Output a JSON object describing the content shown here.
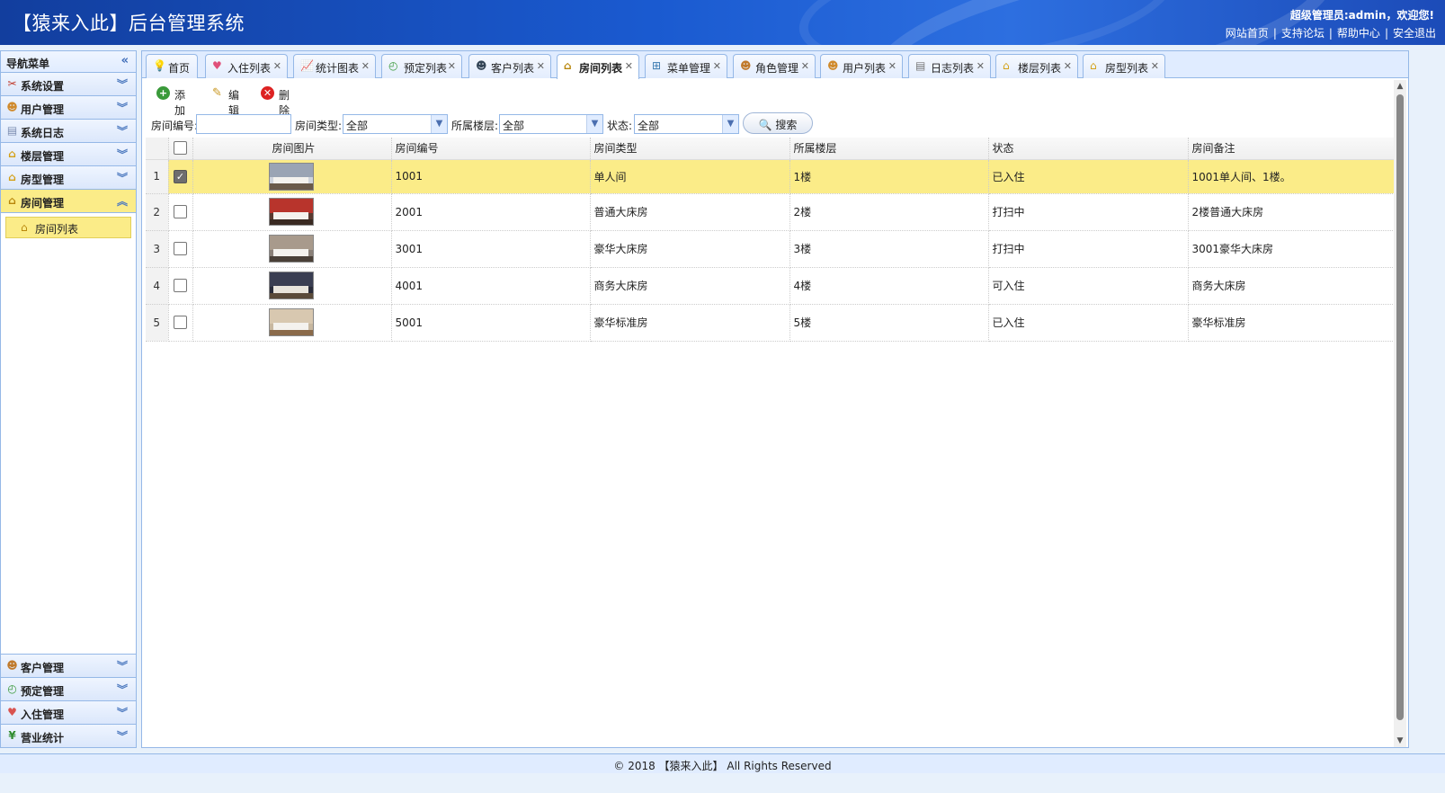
{
  "header": {
    "title": "【猿来入此】后台管理系统",
    "welcome": "超级管理员:admin，欢迎您!",
    "links": [
      "网站首页",
      "支持论坛",
      "帮助中心",
      "安全退出"
    ]
  },
  "sidebar": {
    "title": "导航菜单",
    "groups_top": [
      {
        "label": "系统设置",
        "icon": "tools-icon"
      },
      {
        "label": "用户管理",
        "icon": "user-icon"
      },
      {
        "label": "系统日志",
        "icon": "log-icon"
      },
      {
        "label": "楼层管理",
        "icon": "house-icon"
      },
      {
        "label": "房型管理",
        "icon": "house-icon"
      },
      {
        "label": "房间管理",
        "icon": "house-icon",
        "active": true
      }
    ],
    "sub_items": [
      {
        "label": "房间列表",
        "icon": "house-icon"
      }
    ],
    "groups_bottom": [
      {
        "label": "客户管理",
        "icon": "users-icon"
      },
      {
        "label": "预定管理",
        "icon": "clock-icon"
      },
      {
        "label": "入住管理",
        "icon": "heart-icon"
      },
      {
        "label": "营业统计",
        "icon": "yen-icon"
      }
    ]
  },
  "tabs": [
    {
      "label": "首页",
      "icon": "bulb-icon",
      "closable": false
    },
    {
      "label": "入住列表",
      "icon": "heart-icon",
      "closable": true
    },
    {
      "label": "统计图表",
      "icon": "chart-icon",
      "closable": true
    },
    {
      "label": "预定列表",
      "icon": "clock-icon",
      "closable": true
    },
    {
      "label": "客户列表",
      "icon": "person-icon",
      "closable": true
    },
    {
      "label": "房间列表",
      "icon": "house-icon",
      "closable": true,
      "active": true
    },
    {
      "label": "菜单管理",
      "icon": "sitemap-icon",
      "closable": true
    },
    {
      "label": "角色管理",
      "icon": "users-icon",
      "closable": true
    },
    {
      "label": "用户列表",
      "icon": "user-icon",
      "closable": true
    },
    {
      "label": "日志列表",
      "icon": "document-icon",
      "closable": true
    },
    {
      "label": "楼层列表",
      "icon": "house-icon",
      "closable": true
    },
    {
      "label": "房型列表",
      "icon": "house-icon",
      "closable": true
    }
  ],
  "toolbar": {
    "add": "添加",
    "edit": "编辑",
    "delete": "删除"
  },
  "search": {
    "room_no_label": "房间编号:",
    "room_no_value": "",
    "room_type_label": "房间类型:",
    "room_type_value": "全部",
    "floor_label": "所属楼层:",
    "floor_value": "全部",
    "status_label": "状态:",
    "status_value": "全部",
    "button": "搜索"
  },
  "grid": {
    "columns": [
      "房间图片",
      "房间编号",
      "房间类型",
      "所属楼层",
      "状态",
      "房间备注"
    ],
    "rows": [
      {
        "num": "1",
        "checked": true,
        "room_no": "1001",
        "type": "单人间",
        "floor": "1楼",
        "status": "已入住",
        "remark": "1001单人间、1楼。"
      },
      {
        "num": "2",
        "checked": false,
        "room_no": "2001",
        "type": "普通大床房",
        "floor": "2楼",
        "status": "打扫中",
        "remark": "2楼普通大床房"
      },
      {
        "num": "3",
        "checked": false,
        "room_no": "3001",
        "type": "豪华大床房",
        "floor": "3楼",
        "status": "打扫中",
        "remark": "3001豪华大床房"
      },
      {
        "num": "4",
        "checked": false,
        "room_no": "4001",
        "type": "商务大床房",
        "floor": "4楼",
        "status": "可入住",
        "remark": "商务大床房"
      },
      {
        "num": "5",
        "checked": false,
        "room_no": "5001",
        "type": "豪华标准房",
        "floor": "5楼",
        "status": "已入住",
        "remark": "豪华标准房"
      }
    ]
  },
  "footer": "© 2018 【猿来入此】 All Rights Reserved"
}
